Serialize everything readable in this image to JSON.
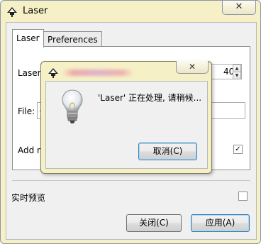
{
  "window": {
    "title": "Laser",
    "close_glyph": "✕"
  },
  "tabs": [
    {
      "label": "Laser",
      "active": true
    },
    {
      "label": "Preferences",
      "active": false
    }
  ],
  "panel": {
    "laser_label": "Laser",
    "laser_value": "40",
    "file_label": "File:",
    "file_value": "c",
    "add_label": "Add n",
    "add_checked": true,
    "check_glyph": "✓"
  },
  "preview": {
    "label": "实时预览",
    "checked": false
  },
  "buttons": {
    "close_label": "关闭(C)",
    "apply_label": "应用(A)"
  },
  "progress_dialog": {
    "message": "'Laser' 正在处理, 请稍候...",
    "cancel_label": "取消(C)",
    "close_glyph": "✕"
  },
  "icons": {
    "app": "inkscape-logo-icon",
    "bulb": "lightbulb-icon"
  },
  "colors": {
    "titlebar": "#f6f0c7",
    "default_button_border": "#3c7fb1"
  }
}
